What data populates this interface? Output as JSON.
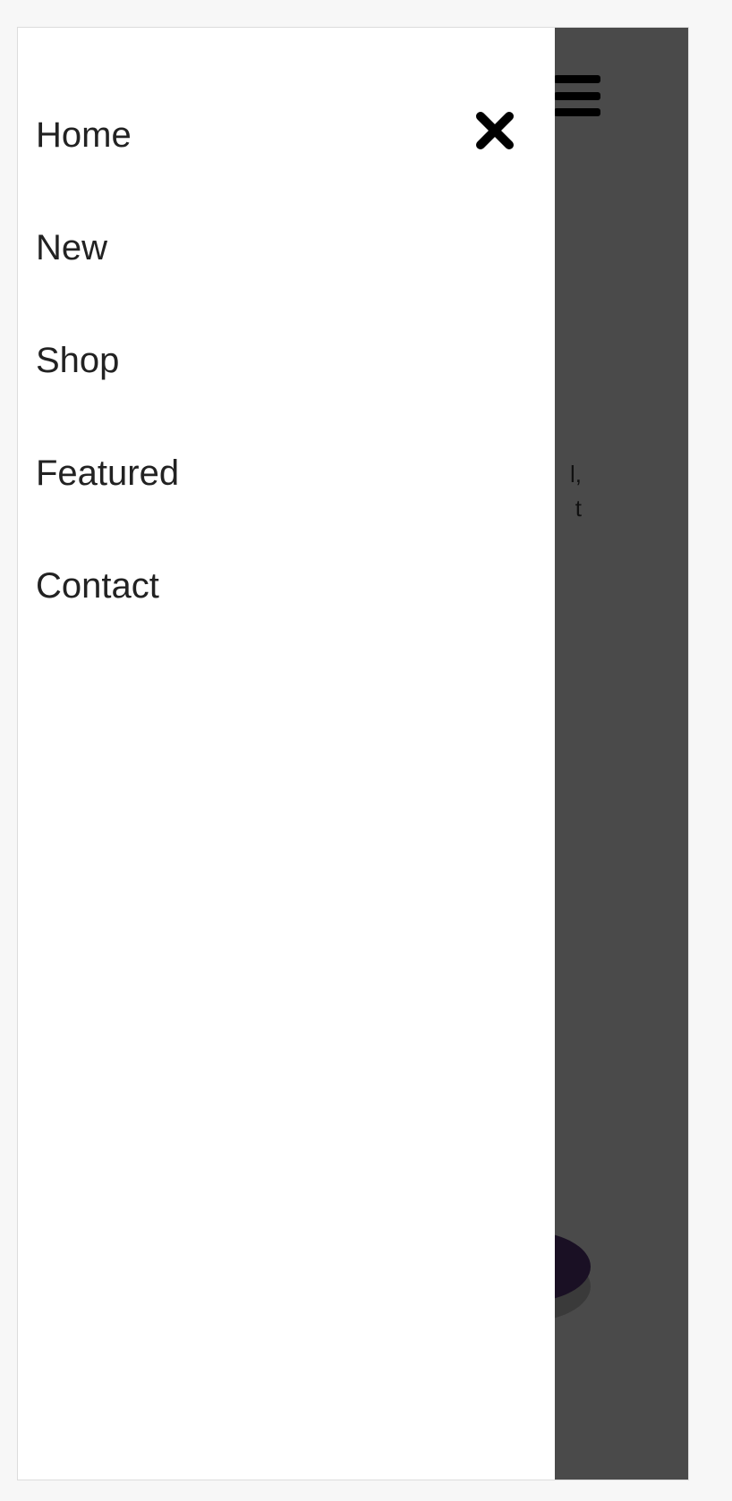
{
  "nav": {
    "items": [
      {
        "label": "Home"
      },
      {
        "label": "New"
      },
      {
        "label": "Shop"
      },
      {
        "label": "Featured"
      },
      {
        "label": "Contact"
      }
    ]
  },
  "background": {
    "partial_text": "l,\nt"
  },
  "icons": {
    "close": "close-icon",
    "menu": "hamburger-menu-icon"
  },
  "colors": {
    "overlay": "#4a4a4a",
    "drawer": "#ffffff",
    "text": "#222222",
    "icon": "#000000"
  }
}
